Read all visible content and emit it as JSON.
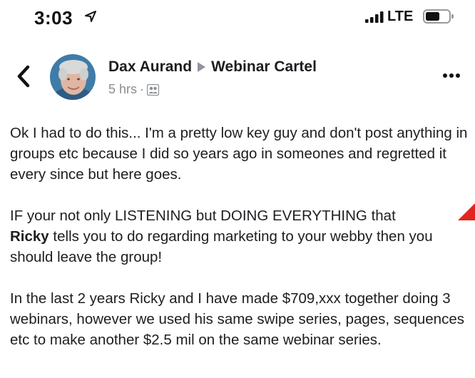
{
  "status_bar": {
    "time": "3:03",
    "carrier": "LTE",
    "icons": [
      "location-arrow-icon",
      "cellular-signal-icon",
      "battery-icon"
    ]
  },
  "post": {
    "author": "Dax Aurand",
    "group": "Webinar Cartel",
    "time_ago": "5 hrs",
    "separator": "·",
    "audience_icon": "group-audience-icon",
    "paragraph_1": "Ok I had to do this... I'm a pretty low key guy and don't post anything in groups etc because I did so years ago in someones and regretted it every since but here goes.",
    "paragraph_2": {
      "part_1": "IF your not only LISTENING but DOING EVERYTHING that",
      "bold_name": "Ricky",
      "part_2": "tells you to do regarding marketing to your webby then you should leave the group!"
    },
    "paragraph_3": "In the last 2 years Ricky and I have made $709,xxx together doing 3 webinars, however we used his same swipe series, pages, sequences etc to make another $2.5 mil on the same webinar series."
  },
  "colors": {
    "text": "#1c1e21",
    "secondary_text": "#8a8d91",
    "annotation_red": "#e0271f"
  }
}
